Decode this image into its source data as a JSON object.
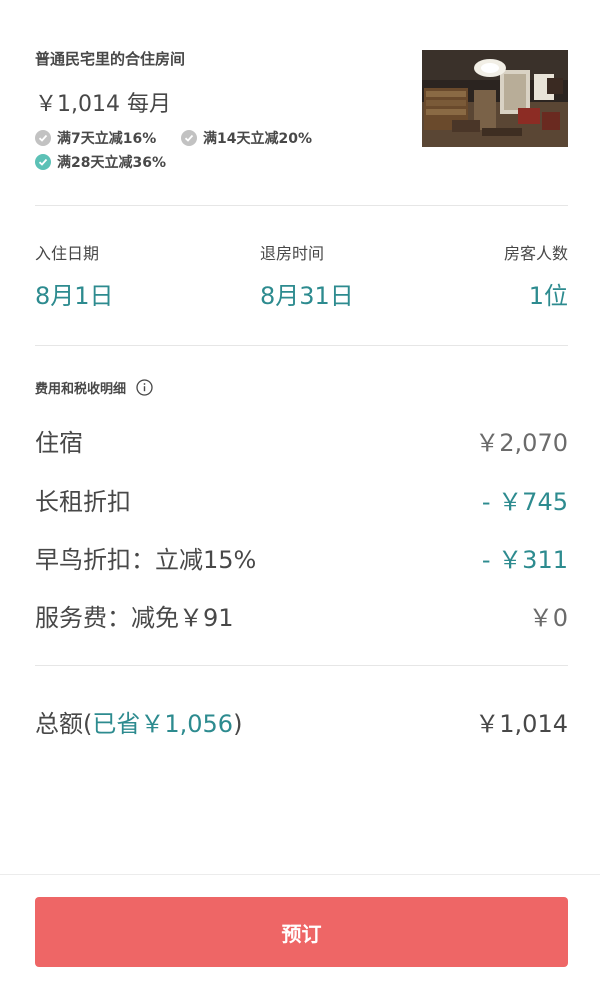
{
  "listing": {
    "title": "普通民宅里的合住房间",
    "price": "￥1,014 每月",
    "discounts": [
      {
        "label": "满7天立减16%",
        "applied": false
      },
      {
        "label": "满14天立减20%",
        "applied": false
      },
      {
        "label": "满28天立减36%",
        "applied": true
      }
    ]
  },
  "stay": {
    "checkin_label": "入住日期",
    "checkin_value": "8月1日",
    "checkout_label": "退房时间",
    "checkout_value": "8月31日",
    "guests_label": "房客人数",
    "guests_value": "1位"
  },
  "fees": {
    "title": "费用和税收明细",
    "rows": [
      {
        "label": "住宿",
        "amount": "￥2,070"
      },
      {
        "label": "长租折扣",
        "amount": "- ￥745"
      },
      {
        "label": "早鸟折扣：立减15%",
        "amount": "- ￥311"
      },
      {
        "label": "服务费：减免￥91",
        "amount": "￥0"
      }
    ]
  },
  "total": {
    "label": "总额(",
    "saved": "已省￥1,056",
    "close": ")",
    "amount": "￥1,014"
  },
  "footer": {
    "book_label": "预订"
  },
  "colors": {
    "accent_teal": "#2d8b8f",
    "check_on": "#5cc1b6",
    "check_off": "#c2c2c2",
    "book_button": "#ee6666"
  }
}
